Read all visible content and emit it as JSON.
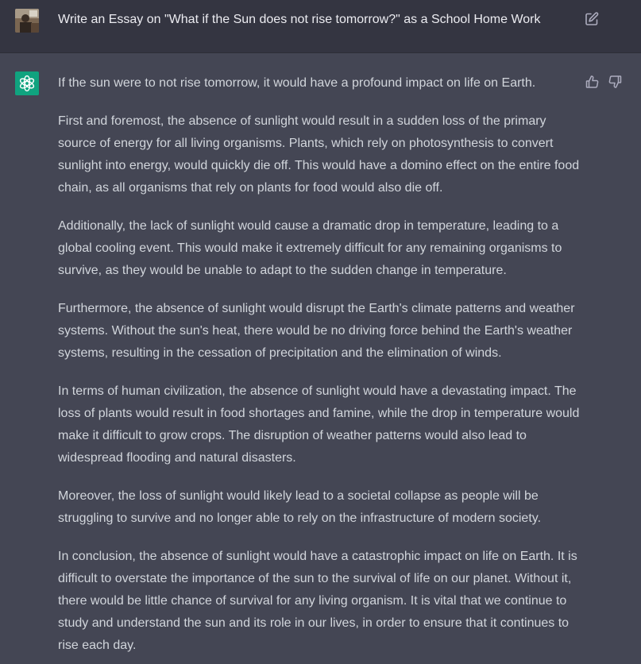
{
  "user_message": {
    "text": "Write an Essay on \"What if the Sun does not rise tomorrow?\" as a School Home Work",
    "avatar_icon": "user-avatar",
    "edit_icon": "edit-icon"
  },
  "assistant_message": {
    "logo_icon": "openai-logo-icon",
    "brand_color": "#10a37f",
    "feedback_icons": [
      "thumbs-up-icon",
      "thumbs-down-icon"
    ],
    "paragraphs": [
      "If the sun were to not rise tomorrow, it would have a profound impact on life on Earth.",
      "First and foremost, the absence of sunlight would result in a sudden loss of the primary source of energy for all living organisms. Plants, which rely on photosynthesis to convert sunlight into energy, would quickly die off. This would have a domino effect on the entire food chain, as all organisms that rely on plants for food would also die off.",
      "Additionally, the lack of sunlight would cause a dramatic drop in temperature, leading to a global cooling event. This would make it extremely difficult for any remaining organisms to survive, as they would be unable to adapt to the sudden change in temperature.",
      "Furthermore, the absence of sunlight would disrupt the Earth's climate patterns and weather systems. Without the sun's heat, there would be no driving force behind the Earth's weather systems, resulting in the cessation of precipitation and the elimination of winds.",
      "In terms of human civilization, the absence of sunlight would have a devastating impact. The loss of plants would result in food shortages and famine, while the drop in temperature would make it difficult to grow crops. The disruption of weather patterns would also lead to widespread flooding and natural disasters.",
      "Moreover, the loss of sunlight would likely lead to a societal collapse as people will be struggling to survive and no longer able to rely on the infrastructure of modern society.",
      "In conclusion, the absence of sunlight would have a catastrophic impact on life on Earth. It is difficult to overstate the importance of the sun to the survival of life on our planet. Without it, there would be little chance of survival for any living organism. It is vital that we continue to study and understand the sun and its role in our lives, in order to ensure that it continues to rise each day."
    ]
  }
}
